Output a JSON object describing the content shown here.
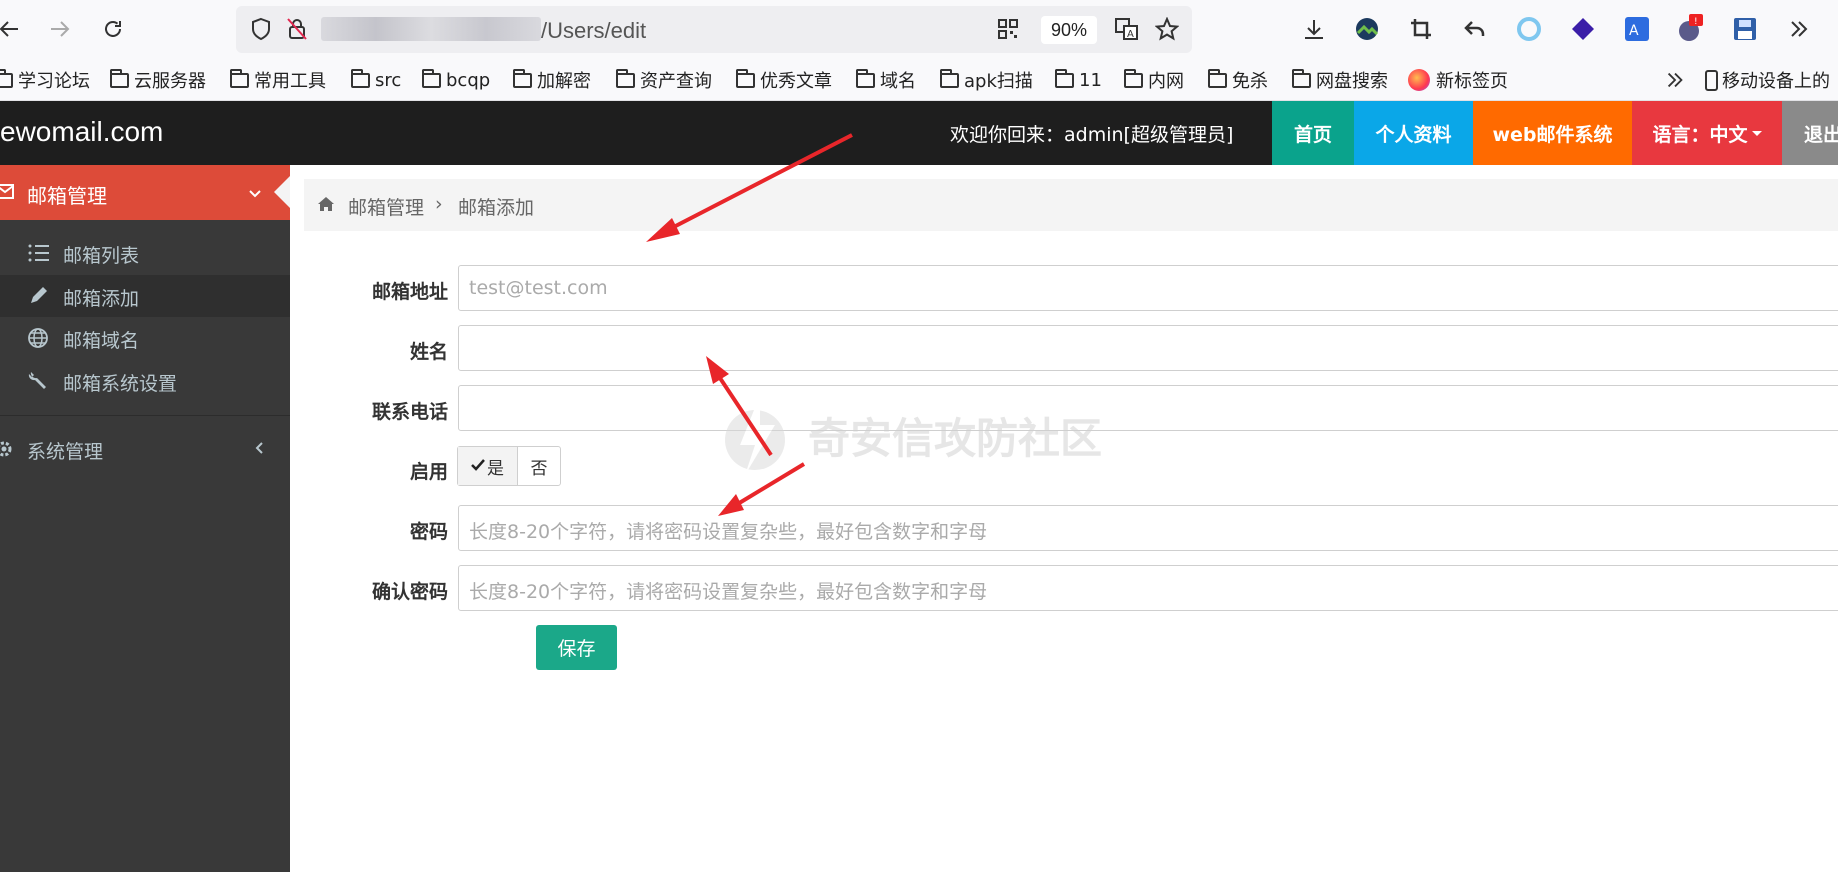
{
  "browser": {
    "url_path": "/Users/edit",
    "zoom": "90%",
    "bookmarks": [
      "学习论坛",
      "云服务器",
      "常用工具",
      "src",
      "bcqp",
      "加解密",
      "资产查询",
      "优秀文章",
      "域名",
      "apk扫描",
      "11",
      "内网",
      "免杀",
      "网盘搜索",
      "新标签页"
    ],
    "mobile_bookmarks": "移动设备上的"
  },
  "header": {
    "logo": "ewomail.com",
    "welcome": "欢迎你回来：admin[超级管理员]",
    "nav": {
      "home": "首页",
      "profile": "个人资料",
      "webmail": "web邮件系统",
      "language": "语言：中文",
      "logout": "退出"
    },
    "colors": {
      "home": "#0aa38c",
      "profile": "#0aa7e8",
      "webmail": "#ff6a00",
      "language": "#e8383f",
      "logout": "#8a8a8a"
    }
  },
  "sidebar": {
    "mailbox_group": "邮箱管理",
    "items": [
      {
        "label": "邮箱列表"
      },
      {
        "label": "邮箱添加"
      },
      {
        "label": "邮箱域名"
      },
      {
        "label": "邮箱系统设置"
      }
    ],
    "system_group": "系统管理"
  },
  "breadcrumb": {
    "root": "邮箱管理",
    "current": "邮箱添加"
  },
  "form": {
    "email_label": "邮箱地址",
    "email_placeholder": "test@test.com",
    "name_label": "姓名",
    "phone_label": "联系电话",
    "enable_label": "启用",
    "enable_yes": "是",
    "enable_no": "否",
    "password_label": "密码",
    "password_placeholder": "长度8-20个字符，请将密码设置复杂些，最好包含数字和字母",
    "confirm_label": "确认密码",
    "confirm_placeholder": "长度8-20个字符，请将密码设置复杂些，最好包含数字和字母",
    "save": "保存"
  },
  "watermark": "奇安信攻防社区"
}
